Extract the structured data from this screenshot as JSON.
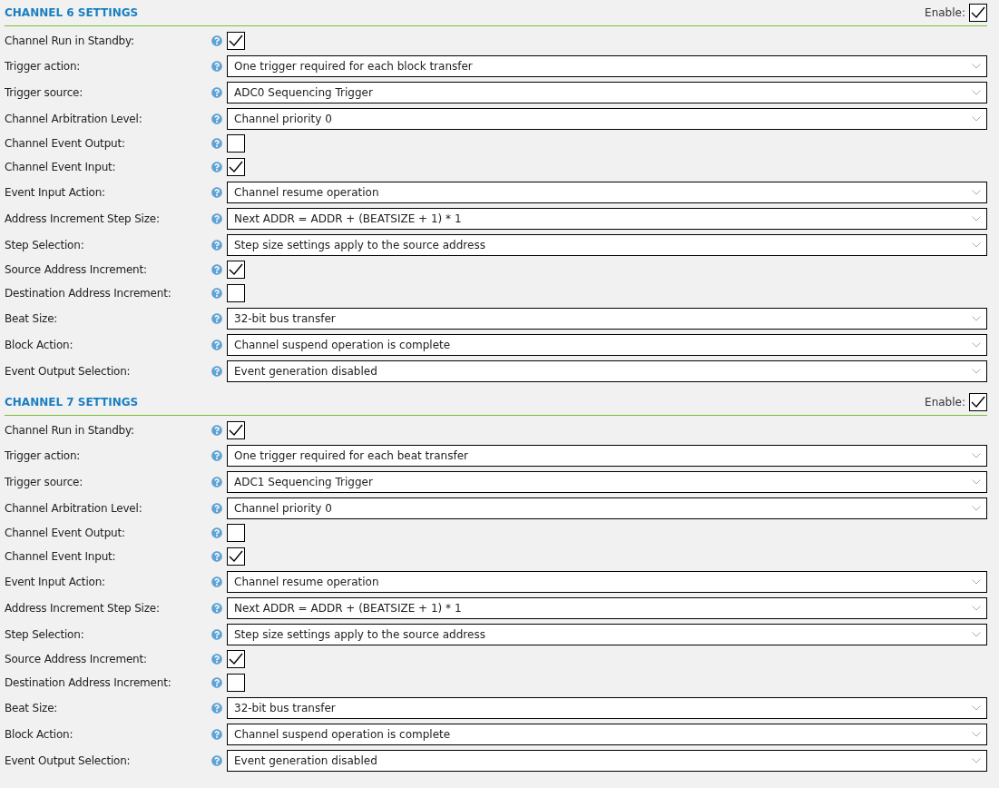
{
  "sections": [
    {
      "title": "CHANNEL 6 SETTINGS",
      "enable_label": "Enable:",
      "enabled": true,
      "fields": [
        {
          "kind": "checkbox",
          "label": "Channel Run in Standby:",
          "checked": true
        },
        {
          "kind": "select",
          "label": "Trigger action:",
          "value": "One trigger required for each block transfer"
        },
        {
          "kind": "select",
          "label": "Trigger source:",
          "value": "ADC0 Sequencing Trigger"
        },
        {
          "kind": "select",
          "label": "Channel Arbitration Level:",
          "value": "Channel priority 0"
        },
        {
          "kind": "checkbox",
          "label": "Channel Event Output:",
          "checked": false
        },
        {
          "kind": "checkbox",
          "label": "Channel Event Input:",
          "checked": true
        },
        {
          "kind": "select",
          "label": "Event Input Action:",
          "value": "Channel resume operation"
        },
        {
          "kind": "select",
          "label": "Address Increment Step Size:",
          "value": "Next ADDR = ADDR + (BEATSIZE + 1) * 1"
        },
        {
          "kind": "select",
          "label": "Step Selection:",
          "value": "Step size settings apply to the source address"
        },
        {
          "kind": "checkbox",
          "label": "Source Address Increment:",
          "checked": true
        },
        {
          "kind": "checkbox",
          "label": "Destination Address Increment:",
          "checked": false
        },
        {
          "kind": "select",
          "label": "Beat Size:",
          "value": "32-bit bus transfer"
        },
        {
          "kind": "select",
          "label": "Block Action:",
          "value": "Channel suspend operation is complete"
        },
        {
          "kind": "select",
          "label": "Event Output Selection:",
          "value": "Event generation disabled"
        }
      ]
    },
    {
      "title": "CHANNEL 7 SETTINGS",
      "enable_label": "Enable:",
      "enabled": true,
      "fields": [
        {
          "kind": "checkbox",
          "label": "Channel Run in Standby:",
          "checked": true
        },
        {
          "kind": "select",
          "label": "Trigger action:",
          "value": "One trigger required for each beat transfer"
        },
        {
          "kind": "select",
          "label": "Trigger source:",
          "value": "ADC1 Sequencing Trigger"
        },
        {
          "kind": "select",
          "label": "Channel Arbitration Level:",
          "value": "Channel priority 0"
        },
        {
          "kind": "checkbox",
          "label": "Channel Event Output:",
          "checked": false
        },
        {
          "kind": "checkbox",
          "label": "Channel Event Input:",
          "checked": true
        },
        {
          "kind": "select",
          "label": "Event Input Action:",
          "value": "Channel resume operation"
        },
        {
          "kind": "select",
          "label": "Address Increment Step Size:",
          "value": "Next ADDR = ADDR + (BEATSIZE + 1) * 1"
        },
        {
          "kind": "select",
          "label": "Step Selection:",
          "value": "Step size settings apply to the source address"
        },
        {
          "kind": "checkbox",
          "label": "Source Address Increment:",
          "checked": true
        },
        {
          "kind": "checkbox",
          "label": "Destination Address Increment:",
          "checked": false
        },
        {
          "kind": "select",
          "label": "Beat Size:",
          "value": "32-bit bus transfer"
        },
        {
          "kind": "select",
          "label": "Block Action:",
          "value": "Channel suspend operation is complete"
        },
        {
          "kind": "select",
          "label": "Event Output Selection:",
          "value": "Event generation disabled"
        }
      ]
    }
  ]
}
